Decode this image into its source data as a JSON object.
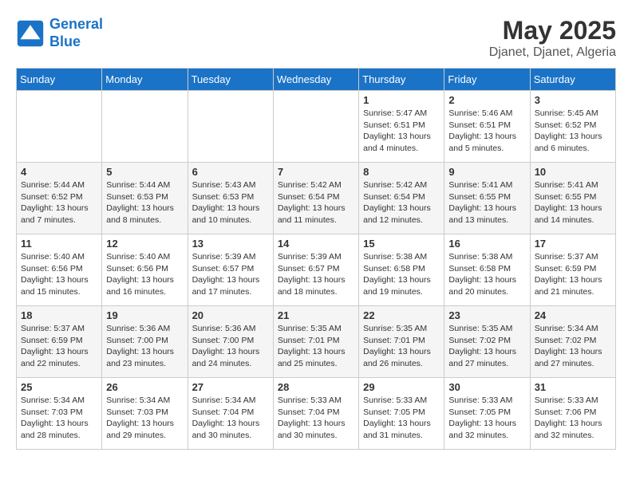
{
  "logo": {
    "line1": "General",
    "line2": "Blue"
  },
  "title": "May 2025",
  "subtitle": "Djanet, Djanet, Algeria",
  "days_of_week": [
    "Sunday",
    "Monday",
    "Tuesday",
    "Wednesday",
    "Thursday",
    "Friday",
    "Saturday"
  ],
  "weeks": [
    [
      {
        "num": "",
        "info": ""
      },
      {
        "num": "",
        "info": ""
      },
      {
        "num": "",
        "info": ""
      },
      {
        "num": "",
        "info": ""
      },
      {
        "num": "1",
        "info": "Sunrise: 5:47 AM\nSunset: 6:51 PM\nDaylight: 13 hours\nand 4 minutes."
      },
      {
        "num": "2",
        "info": "Sunrise: 5:46 AM\nSunset: 6:51 PM\nDaylight: 13 hours\nand 5 minutes."
      },
      {
        "num": "3",
        "info": "Sunrise: 5:45 AM\nSunset: 6:52 PM\nDaylight: 13 hours\nand 6 minutes."
      }
    ],
    [
      {
        "num": "4",
        "info": "Sunrise: 5:44 AM\nSunset: 6:52 PM\nDaylight: 13 hours\nand 7 minutes."
      },
      {
        "num": "5",
        "info": "Sunrise: 5:44 AM\nSunset: 6:53 PM\nDaylight: 13 hours\nand 8 minutes."
      },
      {
        "num": "6",
        "info": "Sunrise: 5:43 AM\nSunset: 6:53 PM\nDaylight: 13 hours\nand 10 minutes."
      },
      {
        "num": "7",
        "info": "Sunrise: 5:42 AM\nSunset: 6:54 PM\nDaylight: 13 hours\nand 11 minutes."
      },
      {
        "num": "8",
        "info": "Sunrise: 5:42 AM\nSunset: 6:54 PM\nDaylight: 13 hours\nand 12 minutes."
      },
      {
        "num": "9",
        "info": "Sunrise: 5:41 AM\nSunset: 6:55 PM\nDaylight: 13 hours\nand 13 minutes."
      },
      {
        "num": "10",
        "info": "Sunrise: 5:41 AM\nSunset: 6:55 PM\nDaylight: 13 hours\nand 14 minutes."
      }
    ],
    [
      {
        "num": "11",
        "info": "Sunrise: 5:40 AM\nSunset: 6:56 PM\nDaylight: 13 hours\nand 15 minutes."
      },
      {
        "num": "12",
        "info": "Sunrise: 5:40 AM\nSunset: 6:56 PM\nDaylight: 13 hours\nand 16 minutes."
      },
      {
        "num": "13",
        "info": "Sunrise: 5:39 AM\nSunset: 6:57 PM\nDaylight: 13 hours\nand 17 minutes."
      },
      {
        "num": "14",
        "info": "Sunrise: 5:39 AM\nSunset: 6:57 PM\nDaylight: 13 hours\nand 18 minutes."
      },
      {
        "num": "15",
        "info": "Sunrise: 5:38 AM\nSunset: 6:58 PM\nDaylight: 13 hours\nand 19 minutes."
      },
      {
        "num": "16",
        "info": "Sunrise: 5:38 AM\nSunset: 6:58 PM\nDaylight: 13 hours\nand 20 minutes."
      },
      {
        "num": "17",
        "info": "Sunrise: 5:37 AM\nSunset: 6:59 PM\nDaylight: 13 hours\nand 21 minutes."
      }
    ],
    [
      {
        "num": "18",
        "info": "Sunrise: 5:37 AM\nSunset: 6:59 PM\nDaylight: 13 hours\nand 22 minutes."
      },
      {
        "num": "19",
        "info": "Sunrise: 5:36 AM\nSunset: 7:00 PM\nDaylight: 13 hours\nand 23 minutes."
      },
      {
        "num": "20",
        "info": "Sunrise: 5:36 AM\nSunset: 7:00 PM\nDaylight: 13 hours\nand 24 minutes."
      },
      {
        "num": "21",
        "info": "Sunrise: 5:35 AM\nSunset: 7:01 PM\nDaylight: 13 hours\nand 25 minutes."
      },
      {
        "num": "22",
        "info": "Sunrise: 5:35 AM\nSunset: 7:01 PM\nDaylight: 13 hours\nand 26 minutes."
      },
      {
        "num": "23",
        "info": "Sunrise: 5:35 AM\nSunset: 7:02 PM\nDaylight: 13 hours\nand 27 minutes."
      },
      {
        "num": "24",
        "info": "Sunrise: 5:34 AM\nSunset: 7:02 PM\nDaylight: 13 hours\nand 27 minutes."
      }
    ],
    [
      {
        "num": "25",
        "info": "Sunrise: 5:34 AM\nSunset: 7:03 PM\nDaylight: 13 hours\nand 28 minutes."
      },
      {
        "num": "26",
        "info": "Sunrise: 5:34 AM\nSunset: 7:03 PM\nDaylight: 13 hours\nand 29 minutes."
      },
      {
        "num": "27",
        "info": "Sunrise: 5:34 AM\nSunset: 7:04 PM\nDaylight: 13 hours\nand 30 minutes."
      },
      {
        "num": "28",
        "info": "Sunrise: 5:33 AM\nSunset: 7:04 PM\nDaylight: 13 hours\nand 30 minutes."
      },
      {
        "num": "29",
        "info": "Sunrise: 5:33 AM\nSunset: 7:05 PM\nDaylight: 13 hours\nand 31 minutes."
      },
      {
        "num": "30",
        "info": "Sunrise: 5:33 AM\nSunset: 7:05 PM\nDaylight: 13 hours\nand 32 minutes."
      },
      {
        "num": "31",
        "info": "Sunrise: 5:33 AM\nSunset: 7:06 PM\nDaylight: 13 hours\nand 32 minutes."
      }
    ]
  ]
}
